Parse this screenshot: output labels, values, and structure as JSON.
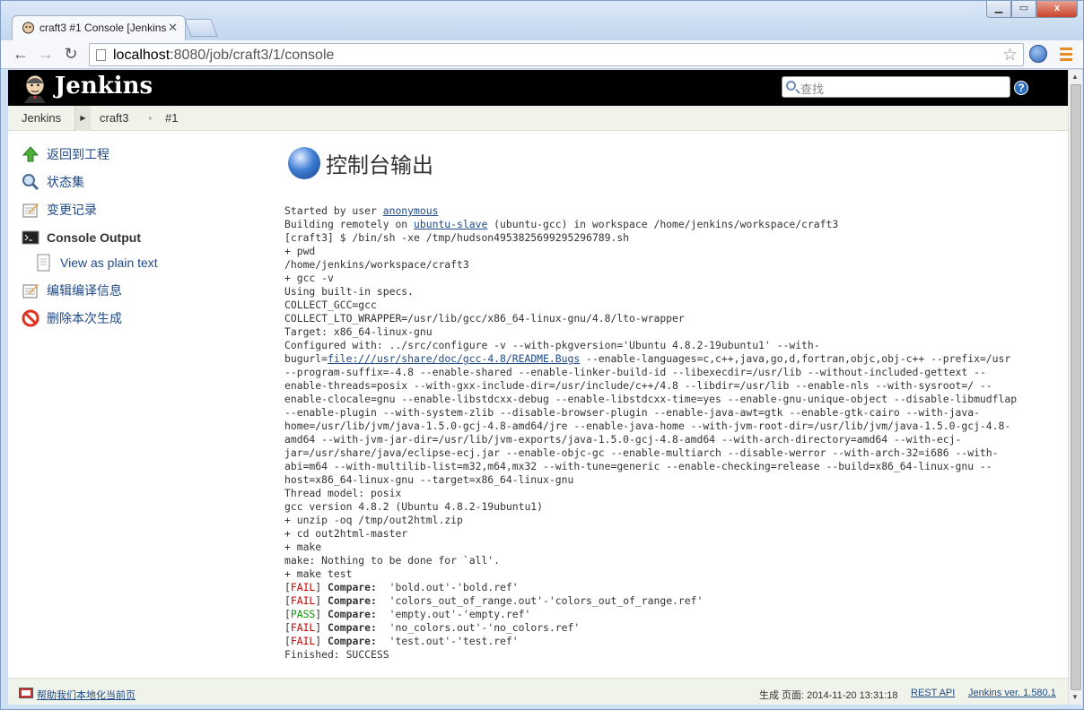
{
  "browser": {
    "tab_title": "craft3 #1 Console [Jenkins",
    "url_host": "localhost",
    "url_rest": ":8080/job/craft3/1/console",
    "window_buttons": {
      "minimize": "▁",
      "maximize": "▭",
      "close": "x"
    }
  },
  "header": {
    "app_name": "Jenkins",
    "search_placeholder": "查找",
    "help_label": "?"
  },
  "breadcrumbs": [
    "Jenkins",
    "craft3",
    "#1"
  ],
  "sidebar": {
    "items": [
      {
        "label": "返回到工程"
      },
      {
        "label": "状态集"
      },
      {
        "label": "变更记录"
      },
      {
        "label": "Console Output"
      },
      {
        "label": "View as plain text"
      },
      {
        "label": "编辑编译信息"
      },
      {
        "label": "删除本次生成"
      }
    ]
  },
  "main": {
    "title": "控制台输出",
    "console": {
      "l1_pre": "Started by user ",
      "l1_link": "anonymous",
      "l2_pre": "Building remotely on ",
      "l2_link": "ubuntu-slave",
      "l2_post": " (ubuntu-gcc) in workspace /home/jenkins/workspace/craft3",
      "l3": "[craft3] $ /bin/sh -xe /tmp/hudson4953825699295296789.sh",
      "l4": "+ pwd",
      "l5": "/home/jenkins/workspace/craft3",
      "l6": "+ gcc -v",
      "l7": "Using built-in specs.",
      "l8": "COLLECT_GCC=gcc",
      "l9": "COLLECT_LTO_WRAPPER=/usr/lib/gcc/x86_64-linux-gnu/4.8/lto-wrapper",
      "l10": "Target: x86_64-linux-gnu",
      "l11": "Configured with: ../src/configure -v --with-pkgversion='Ubuntu 4.8.2-19ubuntu1' --with-",
      "l12_pre": "bugurl=",
      "l12_link": "file:///usr/share/doc/gcc-4.8/README.Bugs",
      "l12_post": " --enable-languages=c,c++,java,go,d,fortran,objc,obj-c++ --prefix=/usr",
      "l13": "--program-suffix=-4.8 --enable-shared --enable-linker-build-id --libexecdir=/usr/lib --without-included-gettext --",
      "l14": "enable-threads=posix --with-gxx-include-dir=/usr/include/c++/4.8 --libdir=/usr/lib --enable-nls --with-sysroot=/ --",
      "l15": "enable-clocale=gnu --enable-libstdcxx-debug --enable-libstdcxx-time=yes --enable-gnu-unique-object --disable-libmudflap",
      "l16": "--enable-plugin --with-system-zlib --disable-browser-plugin --enable-java-awt=gtk --enable-gtk-cairo --with-java-",
      "l17": "home=/usr/lib/jvm/java-1.5.0-gcj-4.8-amd64/jre --enable-java-home --with-jvm-root-dir=/usr/lib/jvm/java-1.5.0-gcj-4.8-",
      "l18": "amd64 --with-jvm-jar-dir=/usr/lib/jvm-exports/java-1.5.0-gcj-4.8-amd64 --with-arch-directory=amd64 --with-ecj-",
      "l19": "jar=/usr/share/java/eclipse-ecj.jar --enable-objc-gc --enable-multiarch --disable-werror --with-arch-32=i686 --with-",
      "l20": "abi=m64 --with-multilib-list=m32,m64,mx32 --with-tune=generic --enable-checking=release --build=x86_64-linux-gnu --",
      "l21": "host=x86_64-linux-gnu --target=x86_64-linux-gnu",
      "l22": "Thread model: posix",
      "l23": "gcc version 4.8.2 (Ubuntu 4.8.2-19ubuntu1)",
      "l24": "+ unzip -oq /tmp/out2html.zip",
      "l25": "+ cd out2html-master",
      "l26": "+ make",
      "l27": "make: Nothing to be done for `all'.",
      "l28": "+ make test",
      "tests": [
        {
          "status": "FAIL",
          "label": "Compare:",
          "detail": "  'bold.out'-'bold.ref'"
        },
        {
          "status": "FAIL",
          "label": "Compare:",
          "detail": "  'colors_out_of_range.out'-'colors_out_of_range.ref'"
        },
        {
          "status": "PASS",
          "label": "Compare:",
          "detail": "  'empty.out'-'empty.ref'"
        },
        {
          "status": "FAIL",
          "label": "Compare:",
          "detail": "  'no_colors.out'-'no_colors.ref'"
        },
        {
          "status": "FAIL",
          "label": "Compare:",
          "detail": "  'test.out'-'test.ref'"
        }
      ],
      "last": "Finished: SUCCESS"
    }
  },
  "footer": {
    "localize_link": "帮助我们本地化当前页",
    "generated": "生成 页面: 2014-11-20 13:31:18",
    "rest_api": "REST API",
    "version": "Jenkins ver. 1.580.1"
  },
  "colors": {
    "fail": "#cc0000",
    "pass": "#009900",
    "link": "#204a87"
  }
}
